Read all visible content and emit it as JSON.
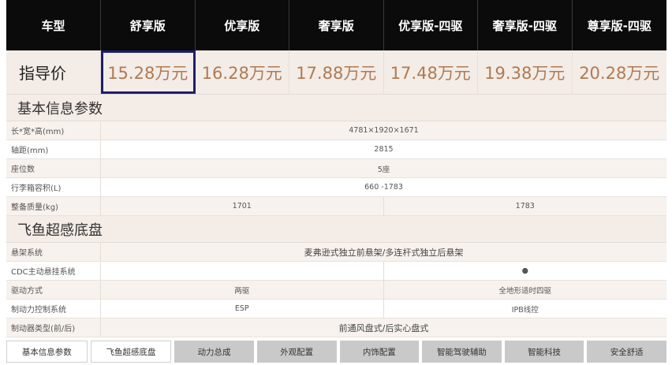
{
  "header": {
    "first_col": "车型",
    "models": [
      "舒享版",
      "优享版",
      "奢享版",
      "优享版-四驱",
      "奢享版-四驱",
      "尊享版-四驱"
    ]
  },
  "price": {
    "label": "指导价",
    "values": [
      "15.28万元",
      "16.28万元",
      "17.88万元",
      "17.48万元",
      "19.38万元",
      "20.28万元"
    ],
    "selected_index": 0
  },
  "sections": {
    "basic": {
      "title": "基本信息参数",
      "rows": [
        {
          "label": "长*宽*高(mm)",
          "values": [
            "4781×1920×1671"
          ]
        },
        {
          "label": "轴距(mm)",
          "values": [
            "2815"
          ]
        },
        {
          "label": "座位数",
          "values": [
            "5座"
          ]
        },
        {
          "label": "行李箱容积(L)",
          "values": [
            "660 -1783"
          ]
        },
        {
          "label": "整备质量(kg)",
          "values": [
            "1701",
            "1783"
          ]
        }
      ]
    },
    "chassis": {
      "title": "飞鱼超感底盘",
      "rows": [
        {
          "label": "悬架系统",
          "values": [
            "麦弗逊式独立前悬架/多连杆式独立后悬架"
          ]
        },
        {
          "label": "CDC主动悬挂系统",
          "values": [
            "",
            "●"
          ]
        },
        {
          "label": "驱动方式",
          "values": [
            "两驱",
            "全地形适时四驱"
          ]
        },
        {
          "label": "制动力控制系统",
          "values": [
            "ESP",
            "IPB线控"
          ]
        },
        {
          "label": "制动器类型(前/后)",
          "values": [
            "前通风盘式/后实心盘式"
          ]
        }
      ]
    }
  },
  "tabs": [
    "基本信息参数",
    "飞鱼超感底盘",
    "动力总成",
    "外观配置",
    "内饰配置",
    "智能驾驶辅助",
    "智能科技",
    "安全舒适"
  ],
  "active_tab_indices": [
    0,
    1
  ],
  "colors": {
    "header_bg": "#0b0b0b",
    "price_text": "#b07a52",
    "selected_outline": "#1d1f6e",
    "section_bg": "#f3ece7",
    "tab_inactive_bg": "#c9c9c9"
  }
}
